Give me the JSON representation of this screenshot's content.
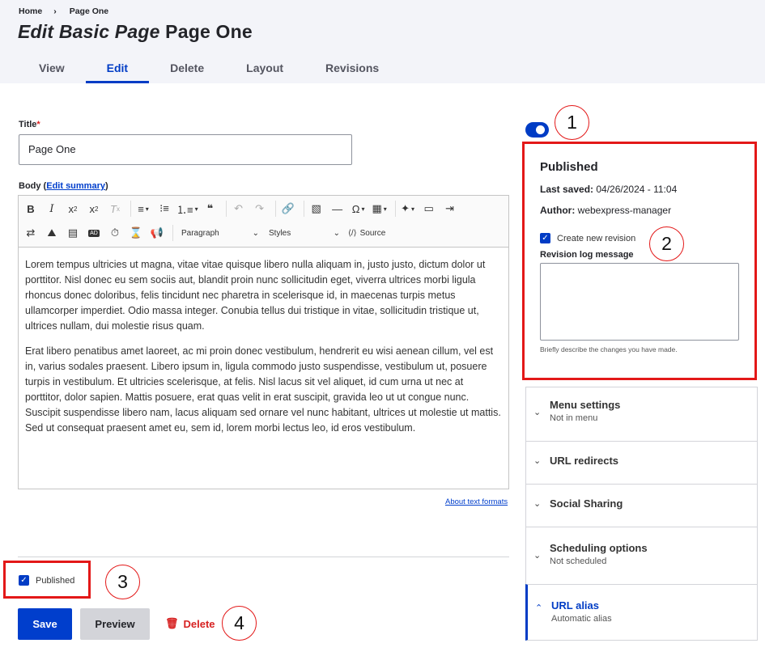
{
  "breadcrumb": {
    "home": "Home",
    "separator": "›",
    "current": "Page One"
  },
  "page_title": {
    "prefix": "Edit Basic Page",
    "name": "Page One"
  },
  "tabs": [
    {
      "label": "View",
      "active": false
    },
    {
      "label": "Edit",
      "active": true
    },
    {
      "label": "Delete",
      "active": false
    },
    {
      "label": "Layout",
      "active": false
    },
    {
      "label": "Revisions",
      "active": false
    }
  ],
  "form": {
    "title_label": "Title",
    "required_mark": "*",
    "title_value": "Page One",
    "body_label": "Body",
    "edit_summary": "Edit summary",
    "paragraph_select": "Paragraph",
    "styles_select": "Styles",
    "source_label": "Source",
    "body_paragraphs": [
      "Lorem tempus ultricies ut magna, vitae vitae quisque libero nulla aliquam in, justo justo, dictum dolor ut porttitor. Nisl donec eu sem sociis aut, blandit proin nunc sollicitudin eget, viverra ultrices morbi ligula rhoncus donec doloribus, felis tincidunt nec pharetra in scelerisque id, in maecenas turpis metus ullamcorper imperdiet. Odio massa integer. Conubia tellus dui tristique in vitae, sollicitudin tristique ut, ultrices nullam, dui molestie risus quam.",
      "Erat libero penatibus amet laoreet, ac mi proin donec vestibulum, hendrerit eu wisi aenean cillum, vel est in, varius sodales praesent. Libero ipsum in, ligula commodo justo suspendisse, vestibulum ut, posuere turpis in vestibulum. Et ultricies scelerisque, at felis. Nisl lacus sit vel aliquet, id cum urna ut nec at porttitor, dolor sapien. Mattis posuere, erat quas velit in erat suscipit, gravida leo ut ut congue nunc. Suscipit suspendisse libero nam, lacus aliquam sed ornare vel nunc habitant, ultrices ut molestie ut mattis. Sed ut consequat praesent amet eu, sem id, lorem morbi lectus leo, id eros vestibulum."
    ],
    "about_formats": "About text formats",
    "published_label": "Published",
    "published_checked": true
  },
  "actions": {
    "save": "Save",
    "preview": "Preview",
    "delete": "Delete"
  },
  "sidebar": {
    "status_title": "Published",
    "last_saved_label": "Last saved:",
    "last_saved_value": "04/26/2024 - 11:04",
    "author_label": "Author:",
    "author_value": "webexpress-manager",
    "new_revision_label": "Create new revision",
    "revision_log_label": "Revision log message",
    "revision_help": "Briefly describe the changes you have made.",
    "accordion": [
      {
        "title": "Menu settings",
        "subtitle": "Not in menu",
        "open": false
      },
      {
        "title": "URL redirects",
        "subtitle": "",
        "open": false
      },
      {
        "title": "Social Sharing",
        "subtitle": "",
        "open": false
      },
      {
        "title": "Scheduling options",
        "subtitle": "Not scheduled",
        "open": false
      },
      {
        "title": "URL alias",
        "subtitle": "Automatic alias",
        "open": true
      }
    ]
  },
  "callouts": [
    "1",
    "2",
    "3",
    "4"
  ],
  "colors": {
    "primary": "#003cc5",
    "danger": "#d72222",
    "highlight": "#e31818"
  }
}
